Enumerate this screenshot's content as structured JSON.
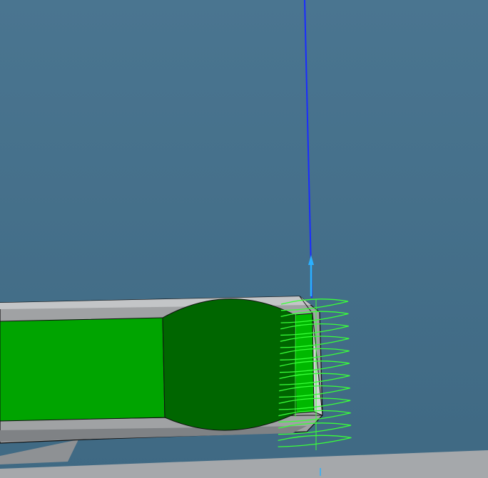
{
  "viewport": {
    "background_top": "#4a7590",
    "background_bottom": "#3f6983"
  },
  "colors": {
    "part_face": "#00a400",
    "part_dark": "#006600",
    "body_gray": "#a0a2a4",
    "edge": "#111111",
    "toolpath": "#39ff39",
    "axis": "#1a2cff",
    "axis_arrow": "#2ab0ff",
    "floor": "#a5a8ab"
  },
  "icons": {
    "axis_arrow": "arrow-up-icon",
    "helix": "helix-toolpath-icon"
  }
}
